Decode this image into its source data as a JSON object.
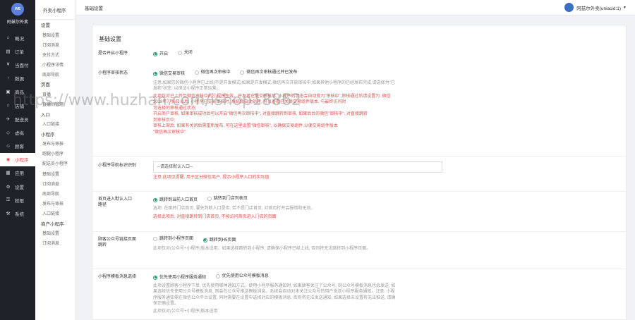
{
  "app": {
    "logo_text": "WE",
    "name": "阿兹尔外卖"
  },
  "left_nav": [
    {
      "label": "概况",
      "icon": "home-icon"
    },
    {
      "label": "订单",
      "icon": "order-icon"
    },
    {
      "label": "当面付",
      "icon": "pay-icon"
    },
    {
      "label": "数据",
      "icon": "data-icon"
    },
    {
      "label": "商品",
      "icon": "goods-icon"
    },
    {
      "label": "店铺",
      "icon": "store-icon"
    },
    {
      "label": "配送员",
      "icon": "courier-icon"
    },
    {
      "label": "虚拟",
      "icon": "virtual-icon"
    },
    {
      "label": "顾客",
      "icon": "customer-icon"
    },
    {
      "label": "小程序",
      "icon": "miniapp-icon"
    },
    {
      "label": "应用",
      "icon": "apps-icon"
    },
    {
      "label": "设置",
      "icon": "settings-icon"
    },
    {
      "label": "权限",
      "icon": "permission-icon"
    },
    {
      "label": "系统",
      "icon": "system-icon"
    }
  ],
  "sub_nav": {
    "title": "外卖小程序",
    "entries": [
      {
        "type": "group",
        "label": "设置"
      },
      {
        "type": "item",
        "label": "基础设置"
      },
      {
        "type": "item",
        "label": "订阅消息"
      },
      {
        "type": "item",
        "label": "支付方式"
      },
      {
        "type": "item",
        "label": "小程序详情"
      },
      {
        "type": "item",
        "label": "底部导航"
      },
      {
        "type": "group",
        "label": "页面"
      },
      {
        "type": "item",
        "label": "直播"
      },
      {
        "type": "item",
        "label": "直播间管理"
      },
      {
        "type": "group",
        "label": "入口"
      },
      {
        "type": "item",
        "label": "入口链接"
      },
      {
        "type": "group",
        "label": "小程序"
      },
      {
        "type": "item",
        "label": "发布与审核"
      },
      {
        "type": "item",
        "label": "跑腿小程序"
      },
      {
        "type": "item",
        "label": "配送员小程序"
      },
      {
        "type": "item",
        "label": "基础设置"
      },
      {
        "type": "item",
        "label": "订阅消息"
      },
      {
        "type": "item",
        "label": "底部导航"
      },
      {
        "type": "item",
        "label": "发布与审核"
      },
      {
        "type": "item",
        "label": "入口链接"
      },
      {
        "type": "group",
        "label": "商户小程序"
      },
      {
        "type": "item",
        "label": "基础设置"
      },
      {
        "type": "item",
        "label": "订阅消息"
      }
    ]
  },
  "topbar": {
    "title": "基础设置",
    "user": "阿兹尔外卖(uniacid:1)"
  },
  "panel": {
    "title": "基础设置",
    "rows": {
      "open": {
        "label": "是否开启小程序",
        "options": [
          "开启",
          "关闭"
        ],
        "selected": 0
      },
      "status": {
        "label": "小程序审核状态",
        "options": [
          "微信交易审核",
          "微信再次审核中",
          "微信再次审核通过并已发布"
        ],
        "selected": 0,
        "help": "注意:如果您的微信小程序已上线(不是开发模式)如果是开发模式,微信再次开放审核中;如果其他小程序的已经发布完成,请选择为\"已发布\"状态; 以保证小程序正常运营。",
        "warn_lines": [
          "此项仅对已上传至微信审核中的小程序生效。开发者在提交审核后, 小程序的状态会自动变为\"审核中\",审核通过后请设置为: 微信",
          "2018年7月6日以后, 小程序已交易审核时, 系统会自动处理, 可以查看已关联交易组件版本, 与最终访问时",
          "可选择的审核通过状态;",
          "开启商户审核, 如果审核成功后可以开启\"微信再次审核中\", 对直接跳转到审核, 如果后台的微信\"审核中\", 对直接跳转",
          "到审核页中;",
          "审核上架后, 如果有关闭后需重新发布, 可在这里设置\"微信审核\", 以确保交易组件,以便交易组件版本",
          "\"微信再次审核中\""
        ]
      },
      "tab": {
        "label": "小程序导航标识识别",
        "placeholder": "--请选择默认入口--",
        "warn": "注意:此项仅提醒, 用于区分微信商户, 提示小程序入口的实际值"
      },
      "jump": {
        "label": "首页进入默认入口",
        "label2": "路径",
        "options": [
          "跳转到当前入口首页",
          "跳转到门店列表页"
        ],
        "selected": 0,
        "help": "选项: 在跳转门店首页, 要先判断入口是否, 若不是门店首页, 对首页打开会报错和无效。",
        "warn": "选择此项后, 对直接跳转到门店首页, 不按访问首页进入门店的页面"
      },
      "mp": {
        "label": "顾客公众号链接页面",
        "label2": "跳转",
        "options": [
          "跳转到小程序页面",
          "跳转到H5页面"
        ],
        "selected": 1,
        "help": "此项仅对(公众号+小程序)版本适用。如果选择跳转到小程序, 请确保小程序已经上线, 否则将无法跳转到小程序页面。"
      },
      "msg": {
        "label": "小程序模板消息选择",
        "options": [
          "优先使用小程序服务通知",
          "优先使用公众号模板消息"
        ],
        "selected": 0,
        "help": "此项设置顾客小程序下单, 优先使用哪种通知方式。使用小程序服务通知时, 如果顾客关注了公众号, 则公众号模板消息也会发送; 如果选择优先使用公众号模板消息, 则会在公众号推送模板消息。系统会自动对未关注公众号的用户发送小程序服务通知。注意: 小程序服务通知需在微信公众平台设置, 同时需要在设置中选择对应的模板消息, 否则将无法发送通知, 如果选择未设置将无法推送, 请确保正确设置。",
        "help2": "此项仅对(公众号+小程序)版本适用"
      }
    }
  },
  "watermark": "https://www.huzhan.com/ishop18862",
  "colors": {
    "nav_bg": "#20222a",
    "active": "#e94545",
    "radio_on": "#1e9e6e",
    "warn": "#d9534f"
  }
}
